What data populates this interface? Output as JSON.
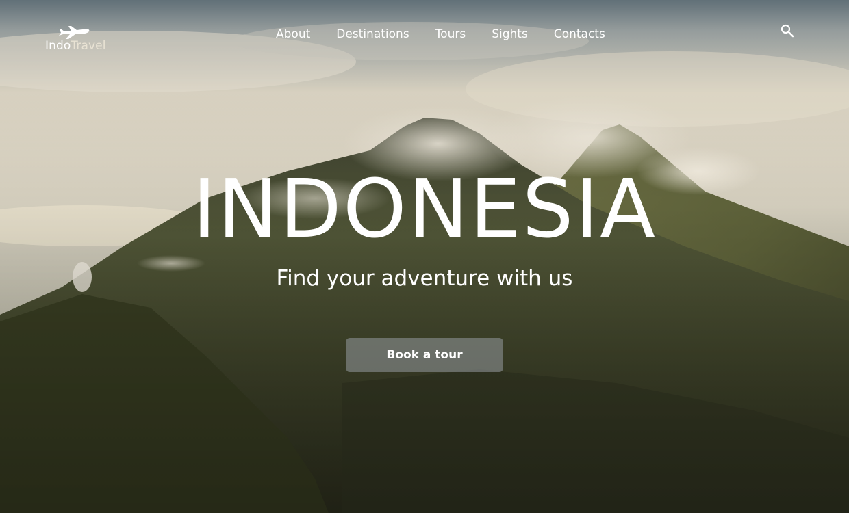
{
  "brand": {
    "name_part1": "Indo",
    "name_part2": "Travel",
    "logo_icon": "airplane-icon"
  },
  "nav": {
    "items": [
      {
        "label": "About"
      },
      {
        "label": "Destinations"
      },
      {
        "label": "Tours"
      },
      {
        "label": "Sights"
      },
      {
        "label": "Contacts"
      }
    ],
    "search_icon": "search-icon"
  },
  "hero": {
    "title": "INDONESIA",
    "subtitle": "Find your adventure with us",
    "cta_label": "Book a tour",
    "background": "mountain-landscape-photo"
  },
  "colors": {
    "text": "#ffffff",
    "button_bg": "#969ba0"
  }
}
